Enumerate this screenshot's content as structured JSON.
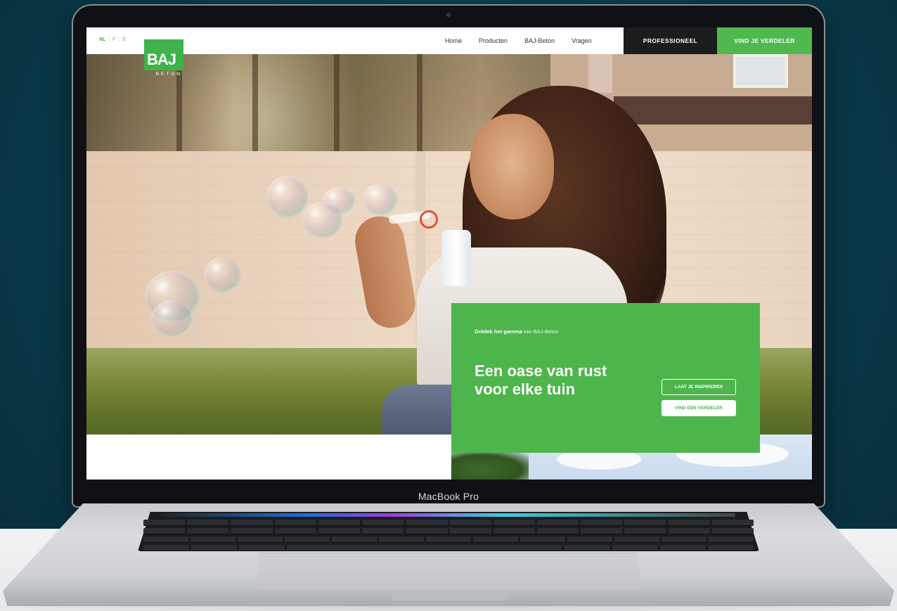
{
  "device": {
    "label": "MacBook Pro"
  },
  "site": {
    "languages": [
      {
        "code": "NL",
        "active": true
      },
      {
        "code": "F",
        "active": false
      },
      {
        "code": "E",
        "active": false
      }
    ],
    "logo": {
      "text": "BAJ",
      "subtext": "BETON",
      "color": "#3fb24a"
    },
    "nav": {
      "links": [
        "Home",
        "Producten",
        "BAJ-Beton",
        "Vragen"
      ],
      "professional_button": "PROFESSIONEEL",
      "distributor_button": "VIND JE VERDELER"
    },
    "hero": {
      "eyebrow_bold": "Ontdek het gamma",
      "eyebrow_rest": " van BAJ-Beton",
      "headline": "Een oase van rust voor elke tuin",
      "primary_button": "LAAT JE INSPIREREN",
      "secondary_button": "VIND EEN VERDELER"
    },
    "colors": {
      "accent_green": "#4db54b",
      "dark": "#1c1c1e",
      "background": "#0a3a4a"
    }
  }
}
